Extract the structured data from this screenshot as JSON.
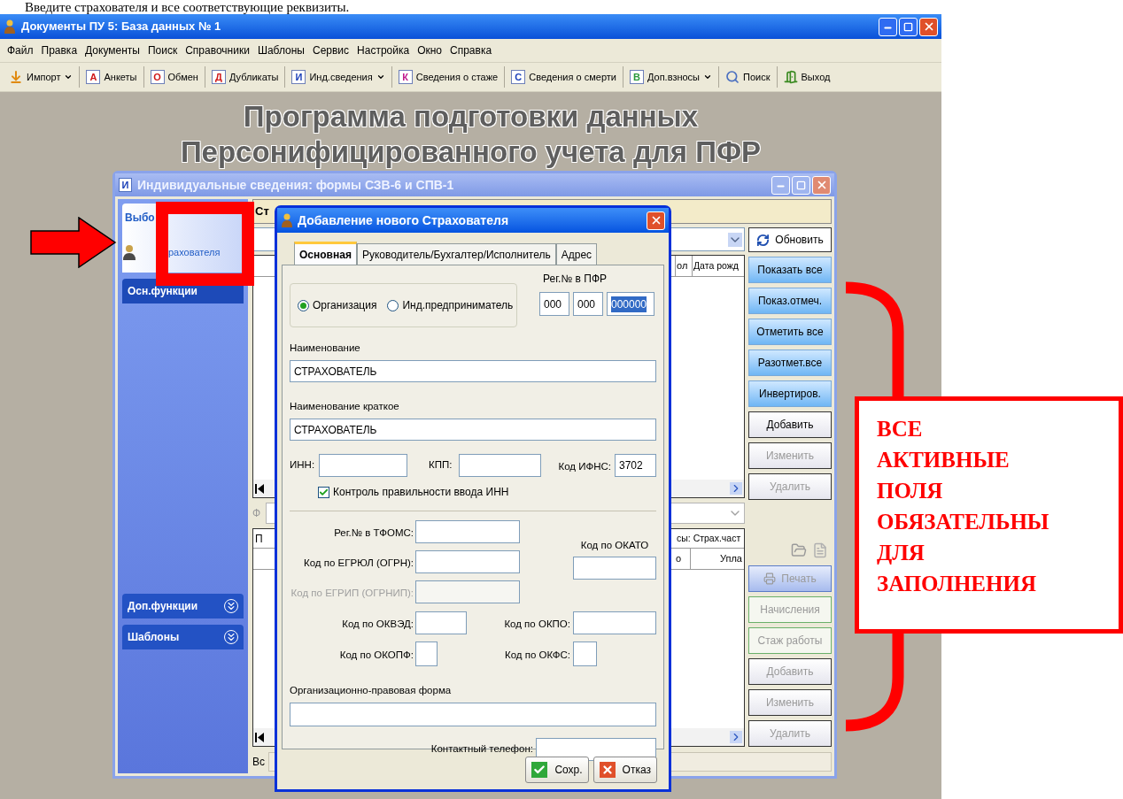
{
  "instruction": "Введите страхователя и все соответствующие реквизиты.",
  "window": {
    "title": "Документы ПУ 5: База данных № 1"
  },
  "menu": [
    "Файл",
    "Правка",
    "Документы",
    "Поиск",
    "Справочники",
    "Шаблоны",
    "Сервис",
    "Настройка",
    "Окно",
    "Справка"
  ],
  "toolbar": [
    {
      "kind": "import",
      "label": "Импорт",
      "dropdown": true
    },
    {
      "kind": "letter",
      "icon_letter": "А",
      "color": "#d01818",
      "label": "Анкеты",
      "dropdown": false
    },
    {
      "kind": "letter",
      "icon_letter": "О",
      "color": "#d01818",
      "label": "Обмен",
      "dropdown": false
    },
    {
      "kind": "letter",
      "icon_letter": "Д",
      "color": "#d01818",
      "label": "Дубликаты",
      "dropdown": false
    },
    {
      "kind": "letter",
      "icon_letter": "И",
      "color": "#1a3fb8",
      "label": "Инд.сведения",
      "dropdown": true
    },
    {
      "kind": "letter",
      "icon_letter": "К",
      "color": "#c0188c",
      "label": "Сведения о стаже",
      "dropdown": false
    },
    {
      "kind": "letter",
      "icon_letter": "С",
      "color": "#1a3fb8",
      "label": "Сведения о смерти",
      "dropdown": false
    },
    {
      "kind": "letter",
      "icon_letter": "В",
      "color": "#2a9a3a",
      "label": "Доп.взносы",
      "dropdown": true
    },
    {
      "kind": "search",
      "label": "Поиск",
      "dropdown": false
    },
    {
      "kind": "exit",
      "label": "Выход",
      "dropdown": false
    }
  ],
  "background_title": [
    "Программа подготовки данных",
    "Персонифицированного учета для ПФР"
  ],
  "child_window": {
    "title": "Индивидуальные сведения: формы СЗВ-6 и СПВ-1",
    "icon_letter": "И",
    "sidebar": {
      "header": "Выбо",
      "item": "рахователя",
      "sections": [
        {
          "label": "Осн.функции",
          "expanded": true
        },
        {
          "label": "Доп.функции",
          "expanded": false
        },
        {
          "label": "Шаблоны",
          "expanded": false
        }
      ]
    },
    "header_fragment": "Ст",
    "table_1": {
      "columns": [
        "ол",
        "Дата рожд"
      ]
    },
    "filter_fragment": "Ф",
    "table_2": {
      "row_fragment": "П",
      "caption": "сы: Страх.част",
      "columns": [
        "о",
        "Упла"
      ]
    },
    "status_fragment": "Вс",
    "buttons_upper": [
      {
        "kind": "refresh",
        "label": "Обновить",
        "disabled": false
      },
      {
        "kind": "blue",
        "label": "Показать все",
        "disabled": false
      },
      {
        "kind": "blue",
        "label": "Показ.отмеч.",
        "disabled": false
      },
      {
        "kind": "blue",
        "label": "Отметить все",
        "disabled": false
      },
      {
        "kind": "blue",
        "label": "Разотмет.все",
        "disabled": false
      },
      {
        "kind": "blue",
        "label": "Инвертиров.",
        "disabled": false
      },
      {
        "kind": "plain",
        "label": "Добавить",
        "disabled": false
      },
      {
        "kind": "plain",
        "label": "Изменить",
        "disabled": true
      },
      {
        "kind": "plain",
        "label": "Удалить",
        "disabled": true
      }
    ],
    "buttons_lower": [
      {
        "kind": "print",
        "label": "Печать",
        "disabled": true
      },
      {
        "kind": "green",
        "label": "Начисления",
        "disabled": true
      },
      {
        "kind": "green",
        "label": "Стаж работы",
        "disabled": true
      },
      {
        "kind": "plain",
        "label": "Добавить",
        "disabled": true
      },
      {
        "kind": "plain",
        "label": "Изменить",
        "disabled": true
      },
      {
        "kind": "plain",
        "label": "Удалить",
        "disabled": true
      }
    ]
  },
  "dialog": {
    "title": "Добавление нового Страхователя",
    "tabs": [
      {
        "label": "Основная",
        "selected": true
      },
      {
        "label": "Руководитель/Бухгалтер/Исполнитель",
        "selected": false
      },
      {
        "label": "Адрес",
        "selected": false
      }
    ],
    "org_type": [
      {
        "label": "Организация",
        "selected": true
      },
      {
        "label": "Инд.предприниматель",
        "selected": false
      }
    ],
    "pfr_reg": {
      "label": "Рег.№ в ПФР",
      "parts": [
        {
          "value": "000",
          "selected": false
        },
        {
          "value": "000",
          "selected": false
        },
        {
          "value": "000000",
          "selected": true
        }
      ]
    },
    "name": {
      "label": "Наименование",
      "value": "СТРАХОВАТЕЛЬ"
    },
    "short_name": {
      "label": "Наименование краткое",
      "value": "СТРАХОВАТЕЛЬ"
    },
    "inn": {
      "label": "ИНН:"
    },
    "kpp": {
      "label": "КПП:"
    },
    "ifns": {
      "label": "Код ИФНС:",
      "value": "3702"
    },
    "inn_check": {
      "label": "Контроль правильности ввода ИНН",
      "checked": true
    },
    "tfoms": {
      "label": "Рег.№ в ТФОМС:",
      "disabled": false
    },
    "ogrn": {
      "label": "Код по ЕГРЮЛ (ОГРН):",
      "disabled": false
    },
    "ogrnip": {
      "label": "Код по ЕГРИП (ОГРНИП):",
      "disabled": true
    },
    "okato": {
      "label": "Код по ОКАТО"
    },
    "okved": {
      "label": "Код по ОКВЭД:"
    },
    "okpo": {
      "label": "Код по ОКПО:"
    },
    "okopf": {
      "label": "Код по ОКОПФ:"
    },
    "okfs": {
      "label": "Код по ОКФС:"
    },
    "legal_form": {
      "label": "Организационно-правовая форма"
    },
    "phone": {
      "label": "Контактный телефон:"
    },
    "buttons": [
      {
        "kind": "save",
        "label": "Сохр."
      },
      {
        "kind": "cancel",
        "label": "Отказ"
      }
    ]
  },
  "annotation": {
    "lines": [
      "ВСЕ",
      "АКТИВНЫЕ",
      "ПОЛЯ",
      "ОБЯЗАТЕЛЬНЫ",
      "ДЛЯ",
      "ЗАПОЛНЕНИЯ"
    ]
  }
}
